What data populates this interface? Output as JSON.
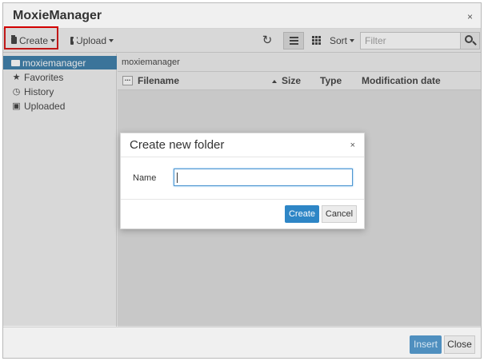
{
  "window": {
    "title": "MoxieManager",
    "close_glyph": "×"
  },
  "toolbar": {
    "create_label": "Create",
    "upload_label": "Upload",
    "sort_label": "Sort",
    "filter_placeholder": "Filter",
    "filter_value": ""
  },
  "sidebar": {
    "items": [
      {
        "label": "moxiemanager",
        "icon": "folder-icon",
        "active": true
      },
      {
        "label": "Favorites",
        "icon": "star-icon"
      },
      {
        "label": "History",
        "icon": "history-icon"
      },
      {
        "label": "Uploaded",
        "icon": "uploaded-icon"
      }
    ]
  },
  "main": {
    "path": "moxiemanager",
    "columns": {
      "select": "...",
      "filename": "Filename",
      "size": "Size",
      "type": "Type",
      "modified": "Modification date"
    },
    "files": []
  },
  "footer": {
    "insert_label": "Insert",
    "close_label": "Close"
  },
  "dialog": {
    "title": "Create new folder",
    "close_glyph": "×",
    "name_label": "Name",
    "name_value": "",
    "create_label": "Create",
    "cancel_label": "Cancel"
  },
  "colors": {
    "accent": "#2c73a3",
    "primary_button": "#2e86c6",
    "highlight_box": "#d20000"
  }
}
